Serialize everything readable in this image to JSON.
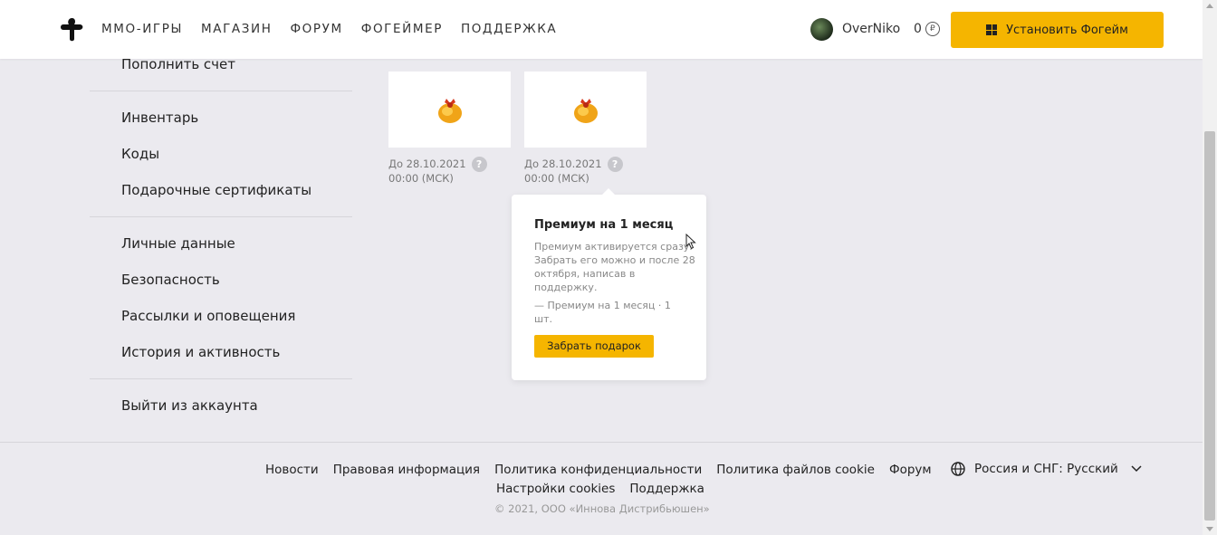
{
  "header": {
    "nav": [
      "ММО-ИГРЫ",
      "МАГАЗИН",
      "ФОРУМ",
      "ФОГЕЙМЕР",
      "ПОДДЕРЖКА"
    ],
    "username": "OverNiko",
    "balance": "0",
    "currency_symbol": "₽",
    "install_label": "Установить Фогейм",
    "accent_color": "#f5b500"
  },
  "sidebar": {
    "items": [
      "Пополнить счет",
      "Инвентарь",
      "Коды",
      "Подарочные сертификаты",
      "Личные данные",
      "Безопасность",
      "Рассылки и оповещения",
      "История и активность",
      "Выйти из аккаунта"
    ]
  },
  "gifts": [
    {
      "date_line1": "До 28.10.2021",
      "date_line2": "00:00 (МСК)",
      "icon": "gift-bag-icon"
    },
    {
      "date_line1": "До 28.10.2021",
      "date_line2": "00:00 (МСК)",
      "icon": "gift-bag-icon"
    }
  ],
  "popup": {
    "title": "Премиум на 1 месяц",
    "description": "Премиум активируется сразу. Забрать его можно и после 28 октября, написав в поддержку.",
    "item": "— Премиум на 1 месяц · 1 шт.",
    "button": "Забрать подарок"
  },
  "footer": {
    "links_row1": [
      "Новости",
      "Правовая информация",
      "Политика конфиденциальности",
      "Политика файлов cookie",
      "Форум"
    ],
    "links_row2": [
      "Настройки cookies",
      "Поддержка"
    ],
    "language": "Россия и СНГ: Русский",
    "copyright": "© 2021, ООО «Иннова Дистрибьюшен»"
  }
}
